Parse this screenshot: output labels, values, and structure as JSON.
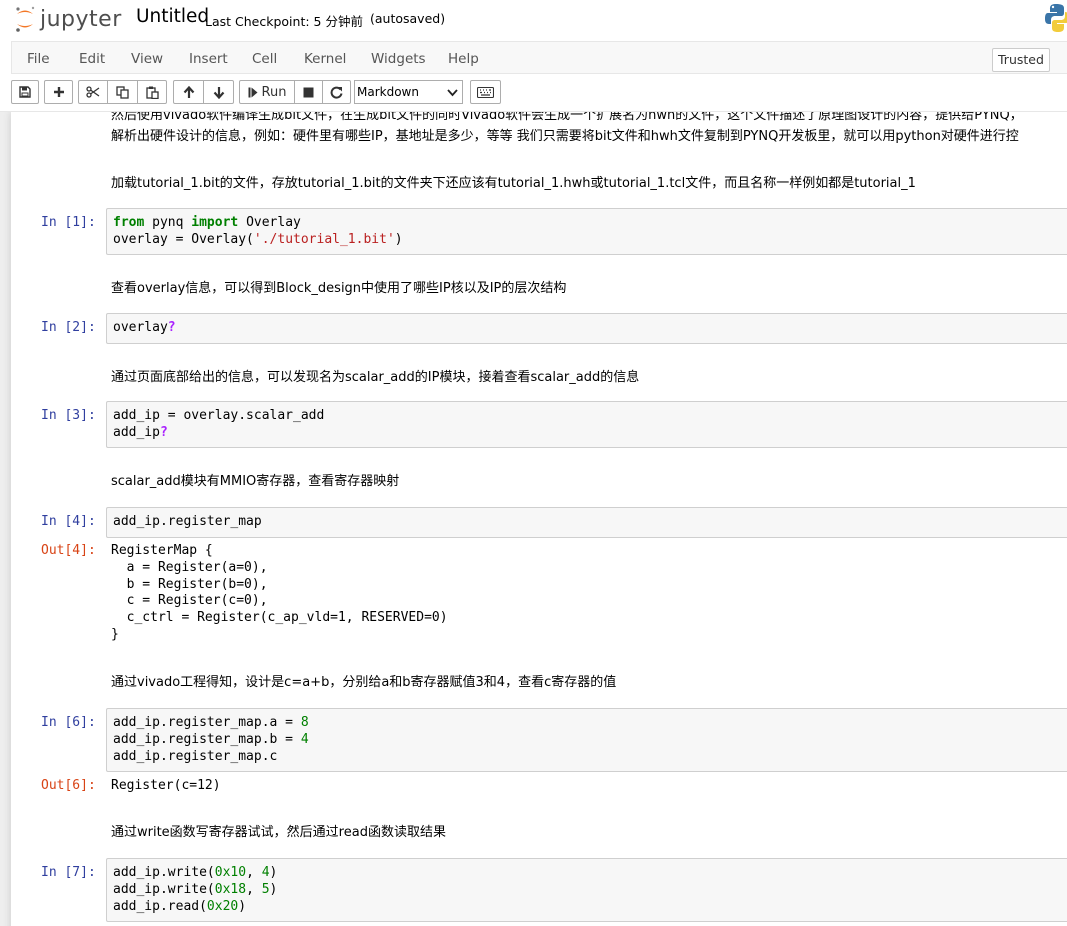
{
  "header": {
    "logo_text": "jupyter",
    "notebook_name": "Untitled",
    "checkpoint": "Last Checkpoint: 5 分钟前",
    "autosave": "(autosaved)"
  },
  "menubar": {
    "items": [
      "File",
      "Edit",
      "View",
      "Insert",
      "Cell",
      "Kernel",
      "Widgets",
      "Help"
    ],
    "trusted": "Trusted"
  },
  "toolbar": {
    "run_label": "Run",
    "cell_type": "Markdown",
    "icons": [
      "save-icon",
      "plus-icon",
      "cut-icon",
      "copy-icon",
      "paste-icon",
      "arrow-up-icon",
      "arrow-down-icon",
      "step-forward-icon",
      "stop-icon",
      "restart-icon",
      "keyboard-icon"
    ]
  },
  "cells": {
    "md0_line1": "然后使用vivado软件编译生成bit文件，在生成bit文件的同时Vivado软件会生成一个扩展名为hwh的文件，这个文件描述了原理图设计的内容，提供给PYNQ，",
    "md0_line2": "解析出硬件设计的信息，例如：硬件里有哪些IP，基地址是多少，等等 我们只需要将bit文件和hwh文件复制到PYNQ开发板里，就可以用python对硬件进行控",
    "md1": "加载tutorial_1.bit的文件，存放tutorial_1.bit的文件夹下还应该有tutorial_1.hwh或tutorial_1.tcl文件，而且名称一样例如都是tutorial_1",
    "in1_prompt": "In [1]:",
    "in1_line1_kw1": "from",
    "in1_line1_mod": " pynq ",
    "in1_line1_kw2": "import",
    "in1_line1_rest": " Overlay",
    "in1_line2_a": "overlay = Overlay(",
    "in1_line2_str": "'./tutorial_1.bit'",
    "in1_line2_b": ")",
    "md2": "查看overlay信息，可以得到Block_design中使用了哪些IP核以及IP的层次结构",
    "in2_prompt": "In [2]:",
    "in2_code": "overlay",
    "in2_q": "?",
    "md3": "通过页面底部给出的信息，可以发现名为scalar_add的IP模块，接着查看scalar_add的信息",
    "in3_prompt": "In [3]:",
    "in3_line1": "add_ip = overlay.scalar_add",
    "in3_line2": "add_ip",
    "in3_q": "?",
    "md4": "scalar_add模块有MMIO寄存器，查看寄存器映射",
    "in4_prompt": "In [4]:",
    "in4_code": "add_ip.register_map",
    "out4_prompt": "Out[4]:",
    "out4_text": "RegisterMap {\n  a = Register(a=0),\n  b = Register(b=0),\n  c = Register(c=0),\n  c_ctrl = Register(c_ap_vld=1, RESERVED=0)\n}",
    "md5": "通过vivado工程得知，设计是c=a+b，分别给a和b寄存器赋值3和4，查看c寄存器的值",
    "in6_prompt": "In [6]:",
    "in6_line1": "add_ip.register_map.a = ",
    "in6_num1": "8",
    "in6_line2": "add_ip.register_map.b = ",
    "in6_num2": "4",
    "in6_line3": "add_ip.register_map.c",
    "out6_prompt": "Out[6]:",
    "out6_text": "Register(c=12)",
    "md6": "通过write函数写寄存器试试，然后通过read函数读取结果",
    "in7_prompt": "In [7]:",
    "in7_l1a": "add_ip.write(",
    "in7_l1n1": "0x10",
    "in7_l1b": ", ",
    "in7_l1n2": "4",
    "in7_l1c": ")",
    "in7_l2a": "add_ip.write(",
    "in7_l2n1": "0x18",
    "in7_l2b": ", ",
    "in7_l2n2": "5",
    "in7_l2c": ")",
    "in7_l3a": "add_ip.read(",
    "in7_l3n1": "0x20",
    "in7_l3c": ")"
  }
}
